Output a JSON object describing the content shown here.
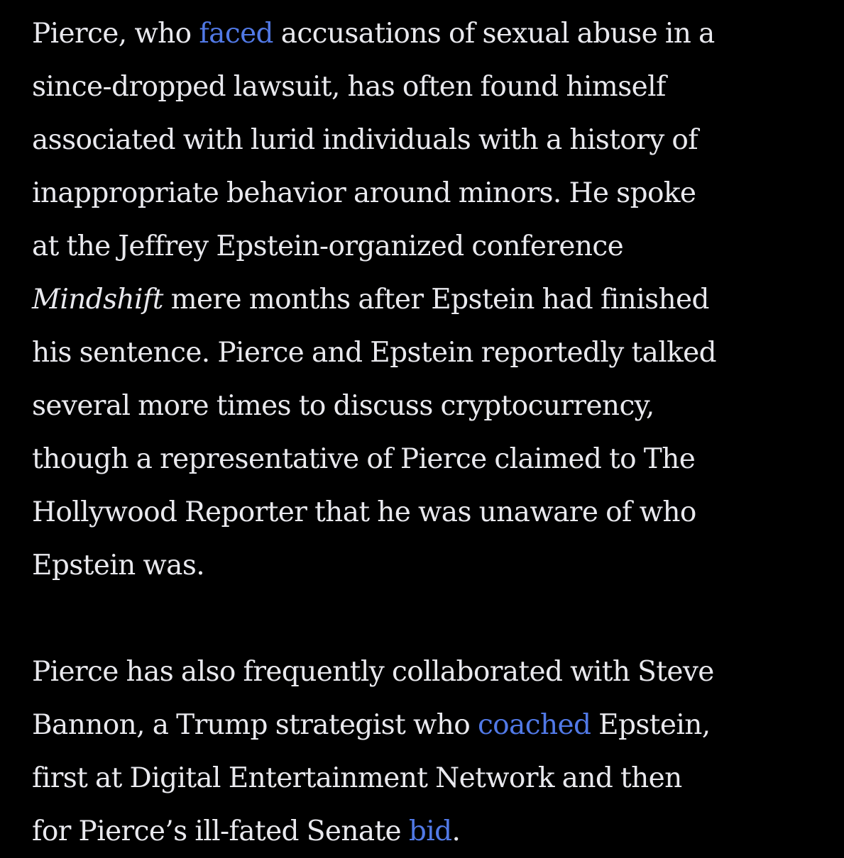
{
  "paragraphs": [
    {
      "lines": [
        {
          "before": "Pierce, who ",
          "link": "faced",
          "after": " accusations of sexual abuse in a"
        },
        {
          "text": "since-dropped lawsuit, has often found himself"
        },
        {
          "text": "associated with lurid individuals with a history of"
        },
        {
          "text": "inappropriate behavior around minors. He spoke"
        },
        {
          "text": "at the Jeffrey Epstein-organized conference"
        },
        {
          "italic": "Mindshift",
          "after": " mere months after Epstein had finished"
        },
        {
          "text": "his sentence. Pierce and Epstein reportedly talked"
        },
        {
          "text": "several more times to discuss cryptocurrency,"
        },
        {
          "text": "though a representative of Pierce claimed to The"
        },
        {
          "text": "Hollywood Reporter that he was unaware of who"
        },
        {
          "text": "Epstein was."
        }
      ]
    },
    {
      "lines": [
        {
          "text": "Pierce has also frequently collaborated with Steve"
        },
        {
          "before": "Bannon, a Trump strategist who ",
          "link": "coached",
          "after": " Epstein,"
        },
        {
          "text": "first at Digital Entertainment Network and then"
        },
        {
          "before": "for Pierce’s ill-fated Senate ",
          "link": "bid",
          "after": "."
        }
      ]
    }
  ],
  "colors": {
    "background": "#000000",
    "text": "#e9e9ee",
    "link": "#5179e6"
  }
}
